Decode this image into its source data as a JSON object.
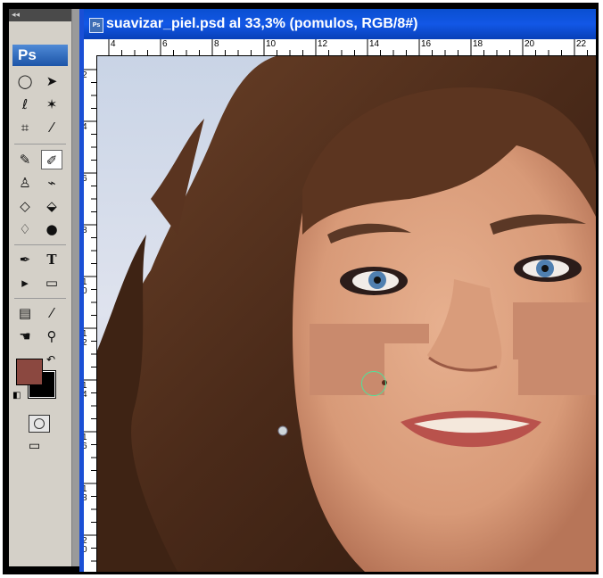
{
  "toolbox": {
    "collapse_glyph": "◂◂",
    "logo": "Ps",
    "tools": [
      {
        "name": "marquee-tool",
        "glyph": "◯"
      },
      {
        "name": "move-tool",
        "glyph": "➤"
      },
      {
        "name": "lasso-tool",
        "glyph": "ℓ"
      },
      {
        "name": "magic-wand-tool",
        "glyph": "✶"
      },
      {
        "name": "crop-tool",
        "glyph": "⌗"
      },
      {
        "name": "slice-tool",
        "glyph": "⁄"
      },
      {
        "name": "healing-brush-tool",
        "glyph": "✎"
      },
      {
        "name": "brush-tool",
        "glyph": "✐"
      },
      {
        "name": "clone-stamp-tool",
        "glyph": "♙"
      },
      {
        "name": "history-brush-tool",
        "glyph": "⌁"
      },
      {
        "name": "eraser-tool",
        "glyph": "◇"
      },
      {
        "name": "paint-bucket-tool",
        "glyph": "⬙"
      },
      {
        "name": "blur-tool",
        "glyph": "♢"
      },
      {
        "name": "dodge-tool",
        "glyph": "●"
      },
      {
        "name": "pen-tool",
        "glyph": "✒"
      },
      {
        "name": "type-tool",
        "glyph": "T"
      },
      {
        "name": "path-selection-tool",
        "glyph": "▸"
      },
      {
        "name": "shape-tool",
        "glyph": "▭"
      },
      {
        "name": "notes-tool",
        "glyph": "▤"
      },
      {
        "name": "eyedropper-tool",
        "glyph": "⁄"
      },
      {
        "name": "hand-tool",
        "glyph": "☚"
      },
      {
        "name": "zoom-tool",
        "glyph": "⚲"
      }
    ],
    "foreground_color": "#8b4840",
    "background_color": "#000000",
    "swap_glyph": "↶",
    "default_colors_glyph": "◧",
    "screen_mode_glyph": "▭"
  },
  "document": {
    "title": "suavizar_piel.psd al 33,3% (pomulos, RGB/8#)",
    "icon_text": "Ps",
    "hruler_labels": [
      "4",
      "6",
      "8",
      "10",
      "12",
      "14",
      "16",
      "18",
      "20",
      "22"
    ],
    "vruler_labels": [
      "2",
      "4",
      "6",
      "8",
      "10",
      "12",
      "14",
      "16",
      "18",
      "20"
    ]
  },
  "colors": {
    "title_bar": "#1257e6",
    "toolbox_bg": "#d4d0c8",
    "cheek_paint": "#c98a6d",
    "brush_cursor": "#4fe39a"
  }
}
